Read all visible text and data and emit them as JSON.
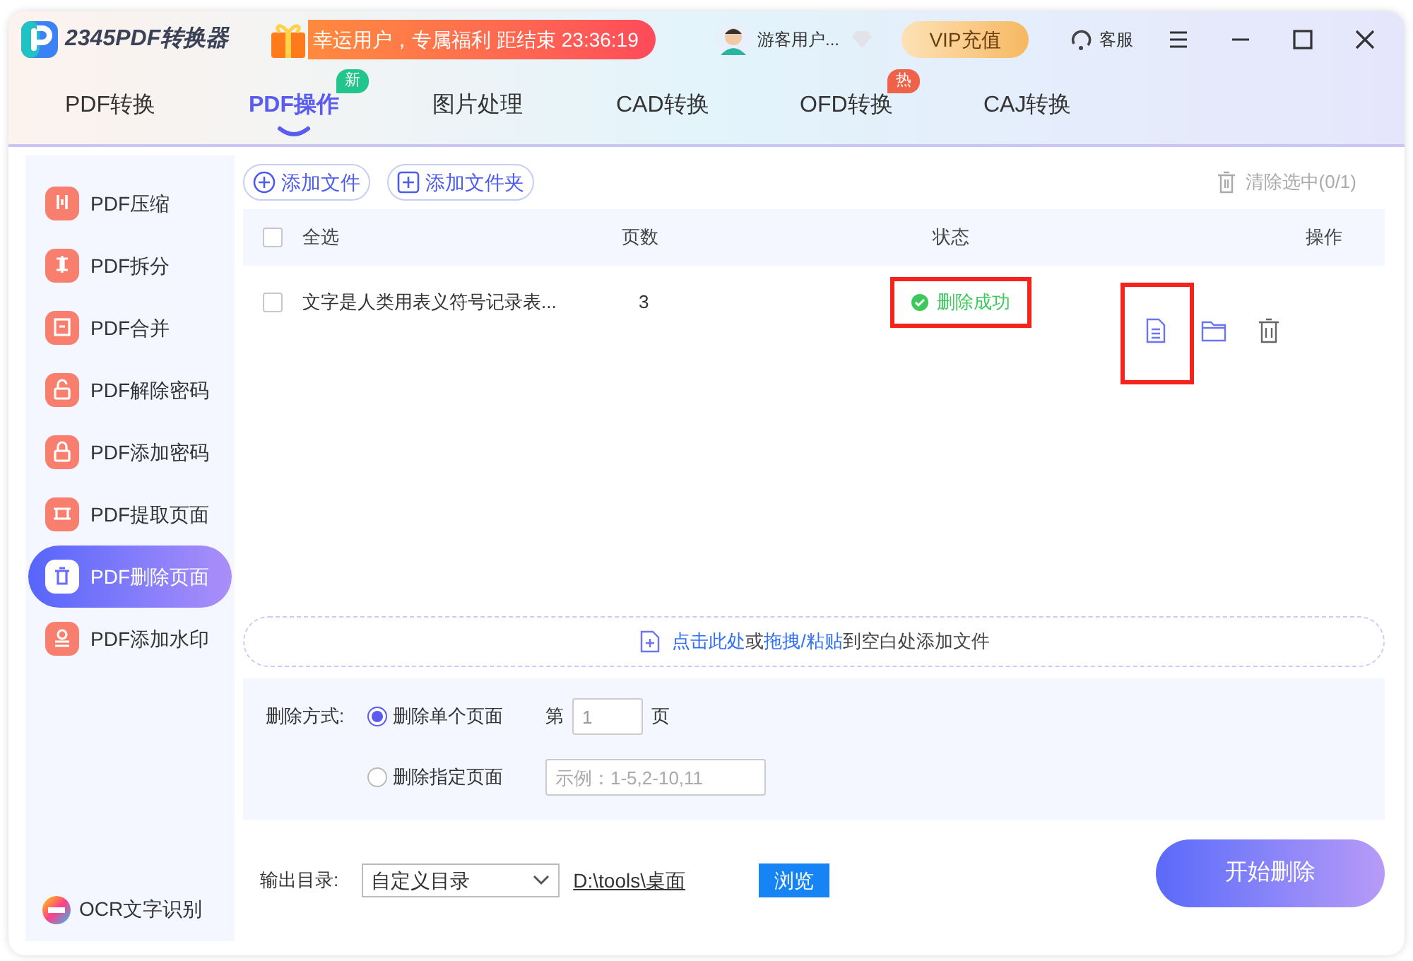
{
  "app": {
    "logo_text": "2345PDF转换器",
    "promo": "幸运用户，专属福利 距结束 23:36:19",
    "user": "游客用户...",
    "vip_button": "VIP充值",
    "service": "客服"
  },
  "tabs": [
    {
      "label": "PDF转换",
      "selected": false
    },
    {
      "label": "PDF操作",
      "selected": true,
      "badge": "新",
      "color": "#22c58b"
    },
    {
      "label": "图片处理",
      "selected": false
    },
    {
      "label": "CAD转换",
      "selected": false
    },
    {
      "label": "OFD转换",
      "selected": false,
      "badge": "热",
      "color": "#f0614a"
    },
    {
      "label": "CAJ转换",
      "selected": false
    }
  ],
  "sidebar": {
    "items": [
      {
        "label": "PDF压缩",
        "kind": "compress",
        "selected": false
      },
      {
        "label": "PDF拆分",
        "kind": "split",
        "selected": false
      },
      {
        "label": "PDF合并",
        "kind": "merge",
        "selected": false
      },
      {
        "label": "PDF解除密码",
        "kind": "unlock",
        "selected": false
      },
      {
        "label": "PDF添加密码",
        "kind": "lock",
        "selected": false
      },
      {
        "label": "PDF提取页面",
        "kind": "extract",
        "selected": false
      },
      {
        "label": "PDF删除页面",
        "kind": "delete",
        "selected": true
      },
      {
        "label": "PDF添加水印",
        "kind": "stamp",
        "selected": false
      }
    ],
    "footer": "OCR文字识别"
  },
  "toolbar": {
    "add_file": "添加文件",
    "add_folder": "添加文件夹",
    "clear": "清除选中(0/1)"
  },
  "table": {
    "columns": [
      "全选",
      "页数",
      "状态",
      "操作"
    ],
    "select_all_checked": false,
    "rows": [
      {
        "checked": false,
        "name": "文字是人类用表义符号记录表...",
        "pages": "3",
        "status": "删除成功",
        "status_highlighted": true,
        "actions": [
          {
            "kind": "view",
            "highlighted": true
          },
          {
            "kind": "folder",
            "highlighted": false
          },
          {
            "kind": "delete",
            "highlighted": false
          }
        ]
      }
    ]
  },
  "drop_hint": [
    {
      "text": "点击此处",
      "link": true
    },
    {
      "text": "或",
      "link": false
    },
    {
      "text": "拖拽/粘贴",
      "link": true
    },
    {
      "text": "到空白处添加文件",
      "link": false
    }
  ],
  "options": {
    "label": "删除方式:",
    "modes": [
      {
        "label": "删除单个页面",
        "selected": true,
        "prefix": "第",
        "value": "1",
        "suffix": "页"
      },
      {
        "label": "删除指定页面",
        "selected": false,
        "placeholder": "示例：1-5,2-10,11"
      }
    ]
  },
  "output": {
    "label": "输出目录:",
    "select": "自定义目录",
    "path": "D:\\tools\\桌面",
    "browse": "浏览",
    "start": "开始删除"
  }
}
